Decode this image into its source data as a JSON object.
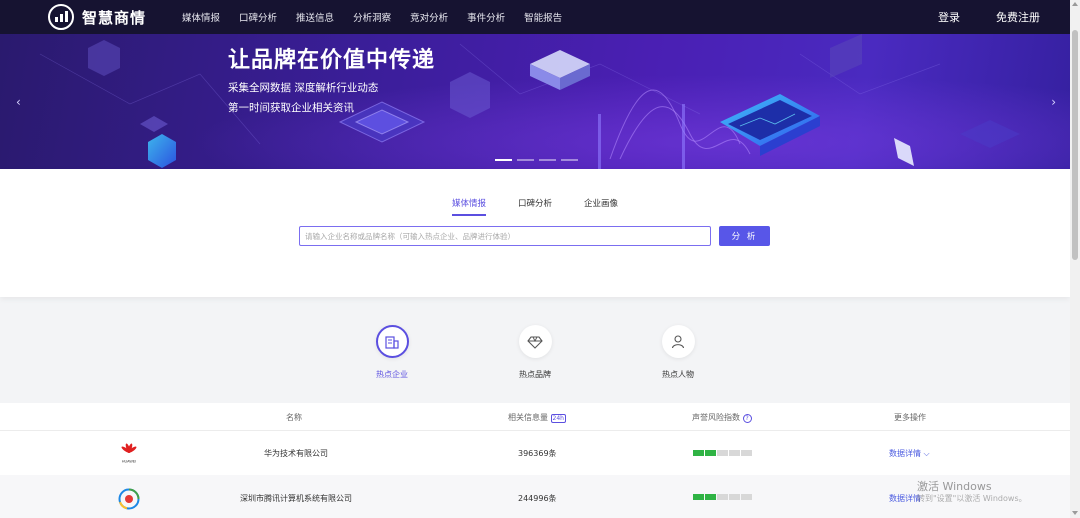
{
  "header": {
    "brand": "智慧商情",
    "nav": [
      "媒体情报",
      "口碑分析",
      "推送信息",
      "分析洞察",
      "竞对分析",
      "事件分析",
      "智能报告"
    ],
    "login": "登录",
    "register": "免费注册"
  },
  "banner": {
    "title": "让品牌在价值中传递",
    "line1": "采集全网数据  深度解析行业动态",
    "line2": "第一时间获取企业相关资讯",
    "prev": "‹",
    "next": "›",
    "slide_count": 4,
    "active_slide": 1
  },
  "search": {
    "tabs": [
      "媒体情报",
      "口碑分析",
      "企业画像"
    ],
    "active_tab": 0,
    "placeholder": "请输入企业名称或品牌名称（可输入热点企业、品牌进行体验）",
    "button": "分 析"
  },
  "categories": [
    {
      "label": "热点企业",
      "icon": "building-icon",
      "active": true
    },
    {
      "label": "热点品牌",
      "icon": "diamond-icon",
      "active": false
    },
    {
      "label": "热点人物",
      "icon": "person-icon",
      "active": false
    }
  ],
  "table": {
    "headers": {
      "name": "名称",
      "count": "相关信息量",
      "count_badge": "24h",
      "risk": "声誉风险指数",
      "risk_help": "?",
      "more": "更多操作"
    },
    "rows": [
      {
        "logo": "huawei-logo",
        "logo_text": "HUAWEI",
        "name": "华为技术有限公司",
        "count": "396369条",
        "risk_level": 2,
        "risk_total": 5,
        "action": "数据详情",
        "action_icon": "chevron-down-icon"
      },
      {
        "logo": "tencent-logo",
        "name": "深圳市腾讯计算机系统有限公司",
        "count": "244996条",
        "risk_level": 2,
        "risk_total": 5,
        "action": "数据详情"
      }
    ]
  },
  "watermark": {
    "line1": "激活 Windows",
    "line2": "转到\"设置\"以激活 Windows。"
  },
  "colors": {
    "accent": "#5b4fe0",
    "nav_bg": "#161331",
    "risk_on": "#2fb344",
    "risk_off": "#d8d8d8"
  }
}
